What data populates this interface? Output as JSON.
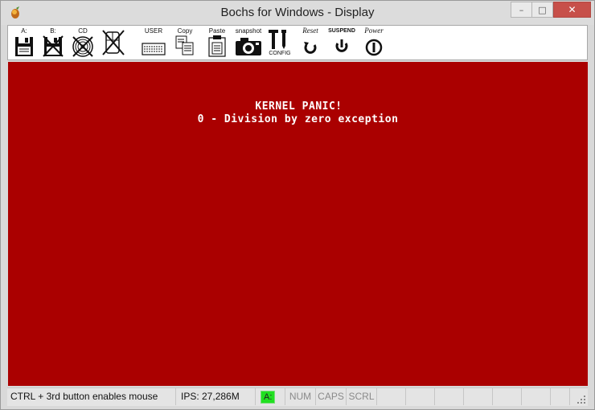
{
  "window": {
    "title": "Bochs for Windows - Display",
    "controls": {
      "minimize": "–",
      "maximize": "□",
      "close": "✕"
    }
  },
  "toolbar": {
    "items": [
      {
        "label": "A:",
        "icon": "floppy-a-icon"
      },
      {
        "label": "B:",
        "icon": "floppy-b-icon"
      },
      {
        "label": "CD",
        "icon": "cdrom-icon"
      },
      {
        "label": "",
        "icon": "mouse-icon"
      },
      {
        "label": "USER",
        "icon": "keyboard-icon"
      },
      {
        "label": "Copy",
        "icon": "copy-icon"
      },
      {
        "label": "Paste",
        "icon": "paste-icon"
      },
      {
        "label": "snapshot",
        "icon": "camera-icon"
      },
      {
        "label": "CONFIG",
        "icon": "config-icon"
      },
      {
        "label": "Reset",
        "icon": "reset-icon"
      },
      {
        "label": "SUSPEND",
        "icon": "suspend-icon"
      },
      {
        "label": "Power",
        "icon": "power-icon"
      }
    ]
  },
  "screen": {
    "background": "#aa0000",
    "line1": "KERNEL PANIC!",
    "line2": "0 - Division by zero exception"
  },
  "statusbar": {
    "message": "CTRL + 3rd button enables mouse",
    "ips": "IPS: 27,286M",
    "drive": "A:",
    "num": "NUM",
    "caps": "CAPS",
    "scrl": "SCRL"
  }
}
